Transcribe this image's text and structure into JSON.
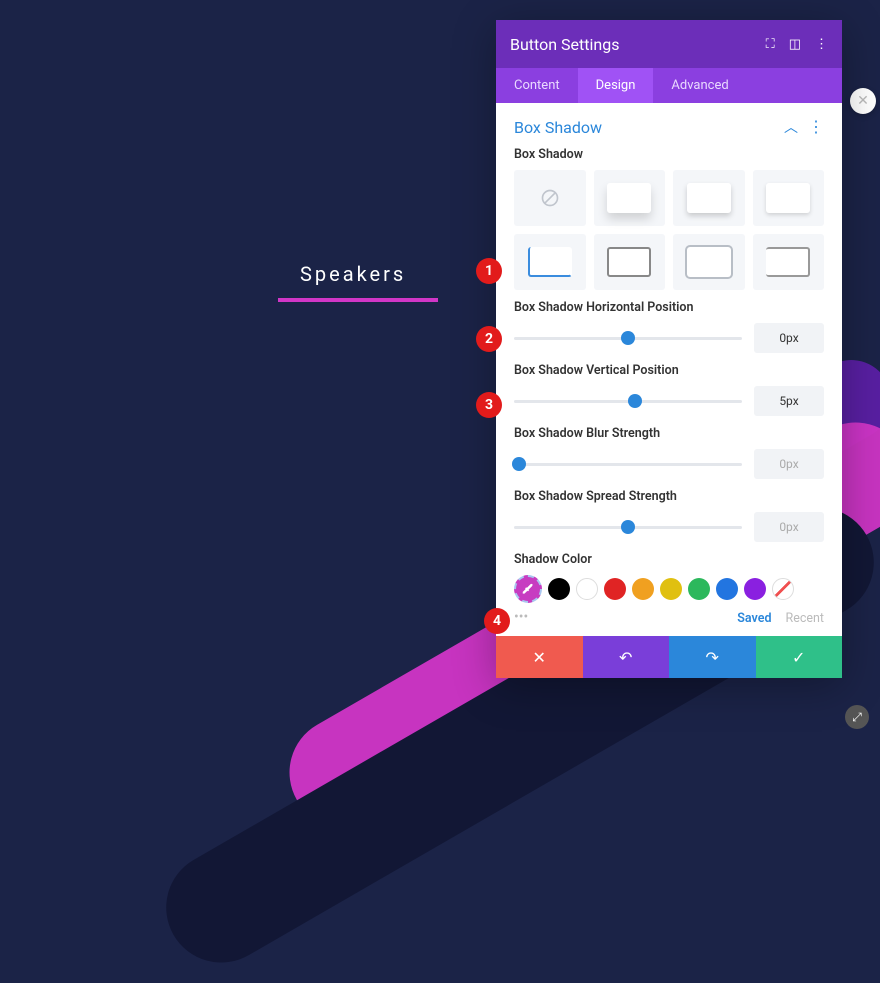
{
  "page": {
    "button_text": "Speakers"
  },
  "panel_title": "Button Settings",
  "tabs": {
    "content": "Content",
    "design": "Design",
    "advanced": "Advanced"
  },
  "section": {
    "title": "Box Shadow"
  },
  "labels": {
    "presets": "Box Shadow",
    "horiz": "Box Shadow Horizontal Position",
    "vert": "Box Shadow Vertical Position",
    "blur": "Box Shadow Blur Strength",
    "spread": "Box Shadow Spread Strength",
    "color": "Shadow Color"
  },
  "values": {
    "horiz": "0px",
    "vert": "5px",
    "blur": "0px",
    "spread": "0px"
  },
  "slider_pos": {
    "horiz": 50,
    "vert": 53,
    "blur": 2,
    "spread": 50
  },
  "color_tabs": {
    "saved": "Saved",
    "recent": "Recent"
  },
  "colors": {
    "picker": "#c73cc1",
    "swatches": [
      "black",
      "white",
      "red",
      "orange",
      "yellow",
      "green",
      "blue",
      "purple",
      "none"
    ]
  },
  "markers": {
    "1": "1",
    "2": "2",
    "3": "3",
    "4": "4"
  }
}
